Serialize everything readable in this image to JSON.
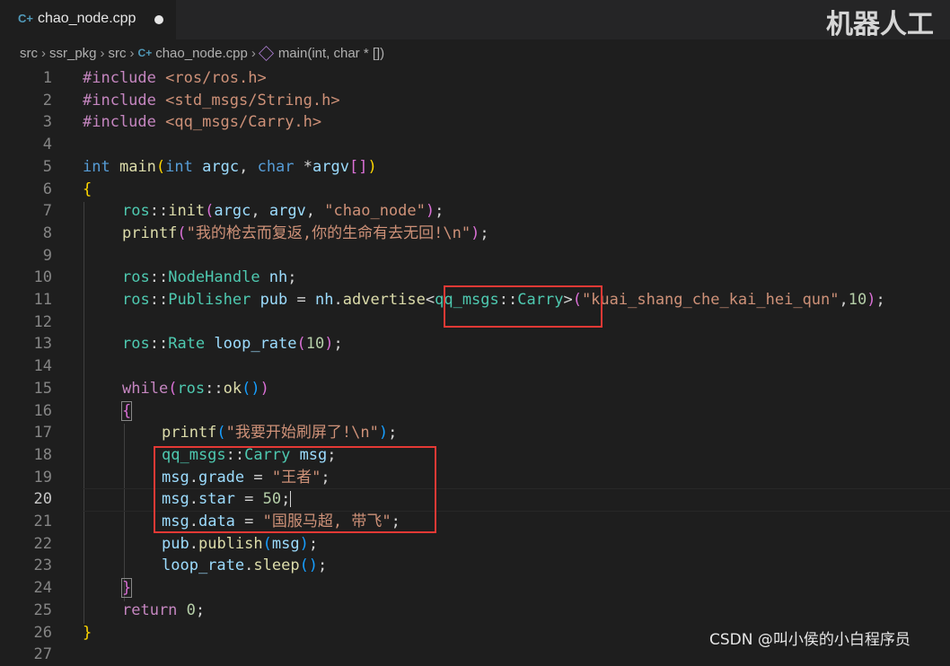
{
  "tab": {
    "icon": "C+",
    "filename": "chao_node.cpp"
  },
  "watermark_top": "机器人工",
  "breadcrumb": {
    "items": [
      "src",
      "ssr_pkg",
      "src",
      "chao_node.cpp",
      "main(int, char * [])"
    ],
    "file_icon": "C+"
  },
  "code": {
    "l1_kw": "#include",
    "l1_h": "<ros/ros.h>",
    "l2_kw": "#include",
    "l2_h": "<std_msgs/String.h>",
    "l3_kw": "#include",
    "l3_h": "<qq_msgs/Carry.h>",
    "l5_a": "int",
    "l5_b": "main",
    "l5_c": "(",
    "l5_d": "int",
    "l5_e": "argc",
    "l5_f": ", ",
    "l5_g": "char",
    "l5_h": " *",
    "l5_i": "argv",
    "l5_j": "[]",
    "l5_k": ")",
    "l6": "{",
    "l7_a": "ros",
    "l7_b": "::",
    "l7_c": "init",
    "l7_d": "(",
    "l7_e": "argc",
    "l7_f": ", ",
    "l7_g": "argv",
    "l7_h": ", ",
    "l7_i": "\"chao_node\"",
    "l7_j": ")",
    "l7_k": ";",
    "l8_a": "printf",
    "l8_b": "(",
    "l8_c": "\"我的枪去而复返,你的生命有去无回!\\n\"",
    "l8_d": ")",
    "l8_e": ";",
    "l10_a": "ros",
    "l10_b": "::",
    "l10_c": "NodeHandle",
    "l10_d": " nh",
    "l10_e": ";",
    "l11_a": "ros",
    "l11_b": "::",
    "l11_c": "Publisher",
    "l11_d": " pub",
    "l11_e": " = ",
    "l11_f": "nh",
    "l11_g": ".",
    "l11_h": "advertise",
    "l11_i": "<",
    "l11_j": "qq_msgs",
    "l11_k": "::",
    "l11_l": "Carry",
    "l11_m": ">",
    "l11_n": "(",
    "l11_o": "\"kuai_shang_che_kai_hei_qun\"",
    "l11_p": ",",
    "l11_q": "10",
    "l11_r": ")",
    "l11_s": ";",
    "l13_a": "ros",
    "l13_b": "::",
    "l13_c": "Rate",
    "l13_d": " loop_rate",
    "l13_e": "(",
    "l13_f": "10",
    "l13_g": ")",
    "l13_h": ";",
    "l15_a": "while",
    "l15_b": "(",
    "l15_c": "ros",
    "l15_d": "::",
    "l15_e": "ok",
    "l15_f": "()",
    "l15_g": ")",
    "l16": "{",
    "l17_a": "printf",
    "l17_b": "(",
    "l17_c": "\"我要开始刷屏了!\\n\"",
    "l17_d": ")",
    "l17_e": ";",
    "l18_a": "qq_msgs",
    "l18_b": "::",
    "l18_c": "Carry",
    "l18_d": " msg",
    "l18_e": ";",
    "l19_a": "msg",
    "l19_b": ".",
    "l19_c": "grade",
    "l19_d": " = ",
    "l19_e": "\"王者\"",
    "l19_f": ";",
    "l20_a": "msg",
    "l20_b": ".",
    "l20_c": "star",
    "l20_d": " = ",
    "l20_e": "50",
    "l20_f": ";",
    "l21_a": "msg",
    "l21_b": ".",
    "l21_c": "data",
    "l21_d": " = ",
    "l21_e": "\"国服马超, 带飞\"",
    "l21_f": ";",
    "l22_a": "pub",
    "l22_b": ".",
    "l22_c": "publish",
    "l22_d": "(",
    "l22_e": "msg",
    "l22_f": ")",
    "l22_g": ";",
    "l23_a": "loop_rate",
    "l23_b": ".",
    "l23_c": "sleep",
    "l23_d": "()",
    "l23_e": ";",
    "l24": "}",
    "l25_a": "return",
    "l25_b": " ",
    "l25_c": "0",
    "l25_d": ";",
    "l26": "}"
  },
  "line_numbers": [
    "1",
    "2",
    "3",
    "4",
    "5",
    "6",
    "7",
    "8",
    "9",
    "10",
    "11",
    "12",
    "13",
    "14",
    "15",
    "16",
    "17",
    "18",
    "19",
    "20",
    "21",
    "22",
    "23",
    "24",
    "25",
    "26",
    "27"
  ],
  "active_line": "20",
  "watermark_bottom": "CSDN @叫小侯的小白程序员",
  "colors": {
    "keyword": "#569cd6",
    "control": "#c586c0",
    "type": "#4ec9b0",
    "function": "#dcdcaa",
    "variable": "#9cdcfe",
    "string": "#ce9178",
    "number": "#b5cea8",
    "highlight_box": "#e53935"
  }
}
